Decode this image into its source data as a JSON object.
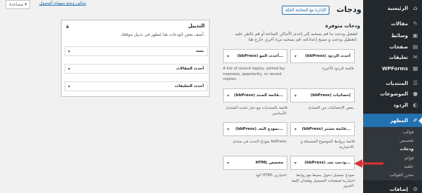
{
  "sidebar": {
    "items": [
      {
        "label": "الرئيسية",
        "icon": "dashboard-icon",
        "glyph": "⌂"
      },
      {
        "label": "مقالات",
        "icon": "pin-icon",
        "glyph": "✎"
      },
      {
        "label": "وسائط",
        "icon": "media-icon",
        "glyph": "▣"
      },
      {
        "label": "صفحات",
        "icon": "pages-icon",
        "glyph": "▤"
      },
      {
        "label": "تعليقات",
        "icon": "comments-icon",
        "glyph": "✉"
      },
      {
        "label": "WPForms",
        "icon": "wpforms-icon",
        "glyph": "▦"
      },
      {
        "label": "المنتديات",
        "icon": "forums-icon",
        "glyph": "☰"
      },
      {
        "label": "الموضوعات",
        "icon": "topics-icon",
        "glyph": "●"
      },
      {
        "label": "الردود",
        "icon": "replies-icon",
        "glyph": "◐"
      },
      {
        "label": "المظهر",
        "icon": "appearance-icon",
        "glyph": "✐"
      },
      {
        "label": "إضافات",
        "icon": "plugins-icon",
        "glyph": "⚙"
      }
    ],
    "submenu": [
      "قوالب",
      "تخصيص",
      "ودجات",
      "قوائم",
      "خلفية",
      "محرر القوالب"
    ]
  },
  "header": {
    "title": "ودجات",
    "manage_button": "الإدارة مع المعاينة الحيّة",
    "help_button": "مساعدة ▾",
    "accessibility_link": "تمكين وضع سهولة الوصول"
  },
  "available": {
    "title": "ودجات متوفرة",
    "description": "لتفعيل ودجت ما قم بسحبه إلى إحدى الأماكن المتاحة أو قم بالنقر عليه. لتعطيل ودجت و مسح إعداداته، قم بسحبه مرة أخرى خارج هنا.",
    "widgets": [
      {
        "title": "(bbPress) أحدث الردود",
        "desc": "قائمة الردود الأخيرة."
      },
      {
        "title": "(bbPress) أحدث المو...",
        "desc": "A list of recent topics, sorted by: newness, popularity, or recent replies."
      },
      {
        "title": "(bbPress) إحصائيات",
        "desc": "بعض الإحصائيات من المنتدى."
      },
      {
        "title": "(bbPress) قائمة المنتد...",
        "desc": "قائمة بالمنتديات مع خيار تحديد المنتدى الأساسي."
      },
      {
        "title": "(bbPress) قائمة مشتر...",
        "desc": "قائمة بروابط الموضوع المسجلة و الاختيارية."
      },
      {
        "title": "(bbPress) نموذج البحـ...",
        "desc": "نموذج البحث في منتدى bbPress."
      },
      {
        "title": "(bbPress) ودجت تسـ...",
        "desc": "نموذج تسجيل دخول بسيط مع روابط اختيارية لصفحات التسجيل وفقدان كلمة المرور."
      },
      {
        "title": "HTML مخصص",
        "desc": "كود HTML اختياري."
      }
    ]
  },
  "area": {
    "title": "التذييل",
    "description": "أضف بعض الودجات هنا لتظهر في تذييل موقعك.",
    "rows": [
      "بحث",
      "أحدث المقالات",
      "أحدث التعليقات"
    ]
  }
}
